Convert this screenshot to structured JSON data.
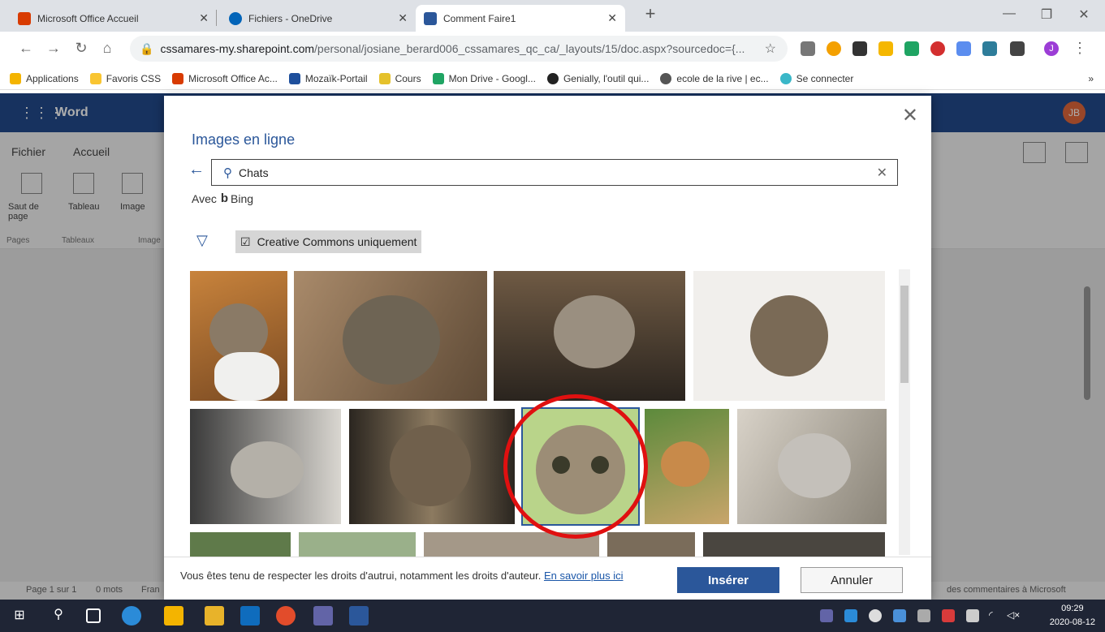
{
  "browser": {
    "tabs": [
      {
        "title": "Microsoft Office Accueil",
        "color": "#d83b01"
      },
      {
        "title": "Fichiers - OneDrive",
        "color": "#0364b8"
      },
      {
        "title": "Comment Faire1",
        "color": "#2b579a"
      }
    ],
    "new_tab": "+",
    "url_host": "cssamares-my.sharepoint.com",
    "url_path": "/personal/josiane_berard006_cssamares_qc_ca/_layouts/15/doc.aspx?sourcedoc={...",
    "bookmarks": [
      {
        "label": "Applications",
        "color": "#f4b400"
      },
      {
        "label": "Favoris CSS",
        "color": "#f9c531"
      },
      {
        "label": "Microsoft Office Ac...",
        "color": "#d83b01"
      },
      {
        "label": "Mozaïk-Portail",
        "color": "#1e4f9c"
      },
      {
        "label": "Cours",
        "color": "#e5c12b"
      },
      {
        "label": "Mon Drive - Googl...",
        "color": "#1fa463"
      },
      {
        "label": "Genially, l'outil qui...",
        "color": "#222222"
      },
      {
        "label": "ecole de la rive | ec...",
        "color": "#555555"
      },
      {
        "label": "Se connecter",
        "color": "#3ab7c8"
      }
    ],
    "more_bookmarks": "»",
    "profile_initial": "J"
  },
  "word": {
    "app_name": "Word",
    "user_initials": "JB",
    "menu": [
      "Fichier",
      "Accueil"
    ],
    "ribbon_buttons": [
      {
        "label": "Saut de page"
      },
      {
        "label": "Tableau"
      },
      {
        "label": "Image"
      }
    ],
    "ribbon_groups": [
      "Pages",
      "Tableaux",
      "Image"
    ],
    "status_left": "Page 1 sur 1",
    "status_words": "0 mots",
    "status_lang": "Fran",
    "status_right": "des commentaires à Microsoft"
  },
  "dialog": {
    "title": "Images en ligne",
    "search_query": "Chats",
    "bing_prefix": "Avec",
    "bing_label": "Bing",
    "filter_label": "Creative Commons uniquement",
    "filter_checked": true,
    "notice_text": "Vous êtes tenu de respecter les droits d'autrui, notamment les droits d'auteur.",
    "learn_more": "En savoir plus ici",
    "insert_label": "Insérer",
    "cancel_label": "Annuler",
    "selected_image_index": 6
  },
  "taskbar": {
    "time": "09:29",
    "date": "2020-08-12"
  },
  "colors": {
    "word_blue": "#2b579a",
    "highlight_circle": "#e01010"
  }
}
